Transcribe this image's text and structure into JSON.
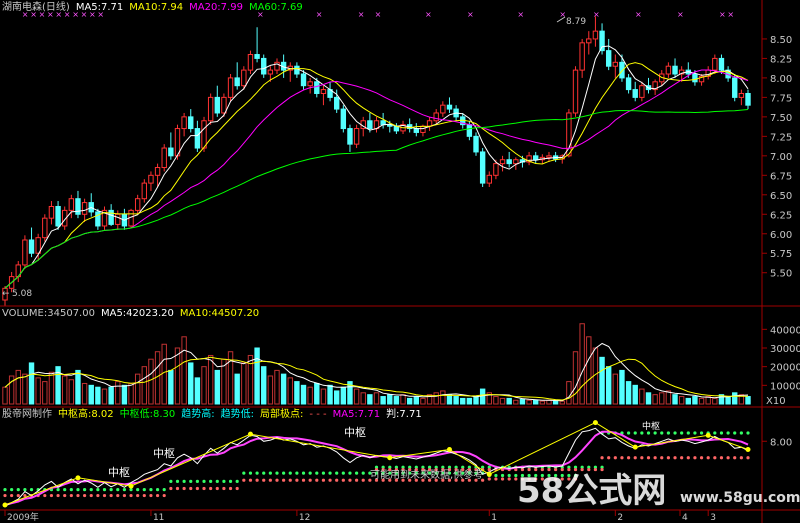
{
  "main_legend": [
    {
      "text": "湖南电森(日线)",
      "color": "#c8c8c8"
    },
    {
      "text": "MA5:7.71",
      "color": "#ffffff"
    },
    {
      "text": "MA10:7.94",
      "color": "#ffff00"
    },
    {
      "text": "MA20:7.99",
      "color": "#ff00ff"
    },
    {
      "text": "MA60:7.69",
      "color": "#00ff00"
    }
  ],
  "vol_legend": [
    {
      "text": "VOLUME:34507.00",
      "color": "#c8c8c8"
    },
    {
      "text": "MA5:42023.20",
      "color": "#ffffff"
    },
    {
      "text": "MA10:44507.20",
      "color": "#ffff00"
    }
  ],
  "ind_legend": [
    {
      "text": "股帝网制作",
      "color": "#c8c8c8"
    },
    {
      "text": "中枢高:8.02",
      "color": "#ffff00"
    },
    {
      "text": "中枢低:8.30",
      "color": "#00ff00"
    },
    {
      "text": "趋势高:",
      "color": "#00ffff"
    },
    {
      "text": "趋势低:",
      "color": "#00ffff"
    },
    {
      "text": "局部极点:",
      "color": "#ffff00"
    },
    {
      "text": "- - -",
      "color": "#ff5555"
    },
    {
      "text": "MA5:7.71",
      "color": "#ff00ff"
    },
    {
      "text": "判:7.71",
      "color": "#ffffff"
    }
  ],
  "annotations": {
    "high_label": "8.79",
    "low_label": "5.08",
    "zs1": "中枢",
    "zs2": "中枢",
    "zs3": "中枢",
    "note": "可能用到未来数据,供参考",
    "ind_tag": "中枢",
    "x_label": "X10"
  },
  "x_axis": {
    "labels": [
      "2009年",
      "11",
      "12",
      "1",
      "2",
      "3",
      "4"
    ]
  },
  "watermark": {
    "big": "58公式网",
    "url": "www.58gu.com"
  },
  "chart_data": [
    {
      "type": "candlestick",
      "title": "湖南电森(日线)",
      "y_ticks": [
        "8.50",
        "8.25",
        "8.00",
        "7.75",
        "7.50",
        "7.25",
        "7.00",
        "6.75",
        "6.50",
        "6.25",
        "6.00",
        "5.75",
        "5.50"
      ],
      "ylim": [
        5.15,
        8.82
      ],
      "x_ticks": [
        "2009年",
        "11",
        "12",
        "1",
        "2",
        "3",
        "4"
      ],
      "ohlc": [
        [
          5.15,
          5.33,
          5.08,
          5.3
        ],
        [
          5.3,
          5.51,
          5.25,
          5.45
        ],
        [
          5.45,
          5.65,
          5.38,
          5.6
        ],
        [
          5.6,
          5.98,
          5.55,
          5.92
        ],
        [
          5.92,
          6.08,
          5.7,
          5.75
        ],
        [
          5.75,
          6.0,
          5.66,
          5.95
        ],
        [
          5.95,
          6.25,
          5.9,
          6.2
        ],
        [
          6.2,
          6.42,
          6.12,
          6.35
        ],
        [
          6.35,
          6.42,
          6.05,
          6.1
        ],
        [
          6.1,
          6.35,
          6.05,
          6.3
        ],
        [
          6.3,
          6.5,
          6.2,
          6.45
        ],
        [
          6.45,
          6.55,
          6.2,
          6.25
        ],
        [
          6.25,
          6.45,
          6.15,
          6.4
        ],
        [
          6.4,
          6.52,
          6.22,
          6.28
        ],
        [
          6.28,
          6.32,
          6.05,
          6.1
        ],
        [
          6.1,
          6.35,
          6.05,
          6.3
        ],
        [
          6.3,
          6.38,
          6.1,
          6.12
        ],
        [
          6.12,
          6.3,
          6.05,
          6.25
        ],
        [
          6.25,
          6.32,
          6.05,
          6.1
        ],
        [
          6.1,
          6.32,
          6.08,
          6.3
        ],
        [
          6.3,
          6.5,
          6.25,
          6.45
        ],
        [
          6.45,
          6.7,
          6.4,
          6.65
        ],
        [
          6.65,
          6.8,
          6.55,
          6.75
        ],
        [
          6.75,
          6.9,
          6.6,
          6.85
        ],
        [
          6.85,
          7.15,
          6.8,
          7.1
        ],
        [
          7.1,
          7.3,
          6.95,
          7.0
        ],
        [
          7.0,
          7.4,
          6.95,
          7.35
        ],
        [
          7.35,
          7.55,
          7.25,
          7.5
        ],
        [
          7.5,
          7.6,
          7.3,
          7.35
        ],
        [
          7.35,
          7.45,
          7.05,
          7.1
        ],
        [
          7.1,
          7.5,
          7.05,
          7.45
        ],
        [
          7.45,
          7.8,
          7.4,
          7.75
        ],
        [
          7.75,
          7.9,
          7.5,
          7.55
        ],
        [
          7.55,
          7.8,
          7.5,
          7.75
        ],
        [
          7.75,
          8.05,
          7.7,
          8.0
        ],
        [
          8.0,
          8.2,
          7.85,
          7.9
        ],
        [
          7.9,
          8.15,
          7.85,
          8.1
        ],
        [
          8.1,
          8.35,
          8.05,
          8.3
        ],
        [
          8.3,
          8.65,
          8.2,
          8.25
        ],
        [
          8.25,
          8.3,
          8.0,
          8.05
        ],
        [
          8.05,
          8.15,
          7.95,
          8.1
        ],
        [
          8.1,
          8.25,
          8.05,
          8.2
        ],
        [
          8.2,
          8.3,
          8.0,
          8.1
        ],
        [
          8.1,
          8.2,
          7.95,
          8.15
        ],
        [
          8.15,
          8.2,
          8.0,
          8.05
        ],
        [
          8.05,
          8.1,
          7.85,
          7.9
        ],
        [
          7.9,
          8.0,
          7.8,
          7.95
        ],
        [
          7.95,
          8.0,
          7.75,
          7.8
        ],
        [
          7.8,
          7.9,
          7.65,
          7.85
        ],
        [
          7.85,
          7.95,
          7.7,
          7.75
        ],
        [
          7.75,
          7.85,
          7.55,
          7.6
        ],
        [
          7.6,
          7.65,
          7.3,
          7.35
        ],
        [
          7.35,
          7.4,
          7.05,
          7.15
        ],
        [
          7.15,
          7.4,
          7.1,
          7.35
        ],
        [
          7.35,
          7.5,
          7.25,
          7.45
        ],
        [
          7.45,
          7.55,
          7.3,
          7.35
        ],
        [
          7.35,
          7.5,
          7.3,
          7.45
        ],
        [
          7.45,
          7.55,
          7.35,
          7.4
        ],
        [
          7.4,
          7.45,
          7.3,
          7.38
        ],
        [
          7.38,
          7.42,
          7.28,
          7.32
        ],
        [
          7.32,
          7.45,
          7.28,
          7.4
        ],
        [
          7.4,
          7.48,
          7.3,
          7.35
        ],
        [
          7.35,
          7.42,
          7.25,
          7.3
        ],
        [
          7.3,
          7.4,
          7.25,
          7.38
        ],
        [
          7.38,
          7.5,
          7.32,
          7.45
        ],
        [
          7.45,
          7.6,
          7.4,
          7.55
        ],
        [
          7.55,
          7.7,
          7.5,
          7.65
        ],
        [
          7.65,
          7.75,
          7.55,
          7.6
        ],
        [
          7.6,
          7.65,
          7.45,
          7.5
        ],
        [
          7.5,
          7.55,
          7.35,
          7.4
        ],
        [
          7.4,
          7.45,
          7.2,
          7.25
        ],
        [
          7.25,
          7.3,
          7.0,
          7.05
        ],
        [
          7.05,
          7.1,
          6.6,
          6.65
        ],
        [
          6.65,
          6.8,
          6.6,
          6.75
        ],
        [
          6.75,
          6.95,
          6.7,
          6.9
        ],
        [
          6.9,
          7.0,
          6.8,
          6.95
        ],
        [
          6.95,
          7.05,
          6.85,
          6.9
        ],
        [
          6.9,
          6.98,
          6.82,
          6.95
        ],
        [
          6.95,
          7.0,
          6.85,
          6.92
        ],
        [
          6.92,
          7.05,
          6.88,
          7.0
        ],
        [
          7.0,
          7.05,
          6.9,
          6.95
        ],
        [
          6.95,
          7.02,
          6.9,
          6.98
        ],
        [
          6.98,
          7.05,
          6.92,
          7.0
        ],
        [
          7.0,
          7.05,
          6.92,
          6.96
        ],
        [
          6.96,
          7.02,
          6.9,
          7.0
        ],
        [
          7.0,
          7.6,
          6.98,
          7.55
        ],
        [
          7.55,
          8.15,
          7.5,
          8.1
        ],
        [
          8.1,
          8.5,
          8.0,
          8.45
        ],
        [
          8.45,
          8.6,
          8.3,
          8.5
        ],
        [
          8.5,
          8.79,
          8.4,
          8.6
        ],
        [
          8.6,
          8.7,
          8.3,
          8.35
        ],
        [
          8.35,
          8.5,
          8.1,
          8.15
        ],
        [
          8.15,
          8.3,
          8.0,
          8.2
        ],
        [
          8.2,
          8.3,
          7.95,
          8.0
        ],
        [
          8.0,
          8.05,
          7.8,
          7.85
        ],
        [
          7.85,
          7.95,
          7.7,
          7.75
        ],
        [
          7.75,
          7.95,
          7.7,
          7.9
        ],
        [
          7.9,
          8.0,
          7.8,
          7.85
        ],
        [
          7.85,
          7.98,
          7.78,
          7.95
        ],
        [
          7.95,
          8.1,
          7.9,
          8.05
        ],
        [
          8.05,
          8.2,
          8.0,
          8.15
        ],
        [
          8.15,
          8.25,
          8.0,
          8.05
        ],
        [
          8.05,
          8.15,
          7.95,
          8.1
        ],
        [
          8.1,
          8.2,
          8.0,
          8.05
        ],
        [
          8.05,
          8.1,
          7.9,
          7.95
        ],
        [
          7.95,
          8.05,
          7.9,
          8.02
        ],
        [
          8.02,
          8.15,
          7.98,
          8.1
        ],
        [
          8.1,
          8.3,
          8.05,
          8.25
        ],
        [
          8.25,
          8.3,
          8.05,
          8.1
        ],
        [
          8.1,
          8.15,
          7.95,
          8.0
        ],
        [
          8.0,
          8.05,
          7.7,
          7.75
        ],
        [
          7.75,
          7.85,
          7.65,
          7.8
        ],
        [
          7.8,
          7.85,
          7.6,
          7.65
        ]
      ],
      "series": [
        {
          "name": "MA5",
          "color": "#ffffff",
          "value": 7.71
        },
        {
          "name": "MA10",
          "color": "#ffff00",
          "value": 7.94
        },
        {
          "name": "MA20",
          "color": "#ff00ff",
          "value": 7.99
        },
        {
          "name": "MA60",
          "color": "#00ff00",
          "value": 7.69
        }
      ]
    },
    {
      "type": "bar",
      "title": "VOLUME",
      "y_ticks": [
        "40000",
        "30000",
        "20000",
        "10000"
      ],
      "ylim": [
        0,
        45000
      ],
      "values": [
        9000,
        15000,
        18000,
        16000,
        22000,
        14000,
        12000,
        17000,
        20000,
        15000,
        13000,
        18000,
        11000,
        10000,
        9000,
        8000,
        9000,
        12000,
        10000,
        11000,
        16000,
        20000,
        24000,
        28000,
        32000,
        18000,
        30000,
        36000,
        22000,
        14000,
        20000,
        26000,
        18000,
        24000,
        28000,
        16000,
        22000,
        26000,
        30000,
        20000,
        15000,
        18000,
        16000,
        14000,
        12000,
        10000,
        9000,
        11000,
        8000,
        10000,
        7000,
        9000,
        12000,
        8000,
        6000,
        5000,
        6000,
        4000,
        5000,
        4000,
        5000,
        3000,
        4000,
        3000,
        5000,
        6000,
        7000,
        5000,
        4000,
        3000,
        3000,
        4000,
        8000,
        6000,
        4000,
        3000,
        3000,
        2000,
        2500,
        2000,
        2000,
        1500,
        2000,
        1800,
        1500,
        12000,
        28000,
        43000,
        36000,
        30000,
        25000,
        20000,
        16000,
        18000,
        12000,
        10000,
        8000,
        6000,
        5000,
        6000,
        7000,
        5000,
        4000,
        3000,
        4000,
        3000,
        4000,
        3000,
        5000,
        4000,
        6000,
        5000,
        4000
      ],
      "series": [
        {
          "name": "MA5",
          "color": "#ffffff",
          "value": 42023.2
        },
        {
          "name": "MA10",
          "color": "#ffff00",
          "value": 44507.2
        }
      ]
    },
    {
      "type": "line",
      "title": "股帝网制作",
      "y_ticks": [
        "8.00"
      ],
      "series": [
        {
          "name": "中枢高",
          "color": "#ffff00",
          "value": 8.02
        },
        {
          "name": "中枢低",
          "color": "#00ff00",
          "value": 8.3
        },
        {
          "name": "MA5",
          "color": "#ff00ff",
          "value": 7.71
        },
        {
          "name": "判",
          "color": "#ffffff",
          "value": 7.71
        }
      ]
    }
  ]
}
